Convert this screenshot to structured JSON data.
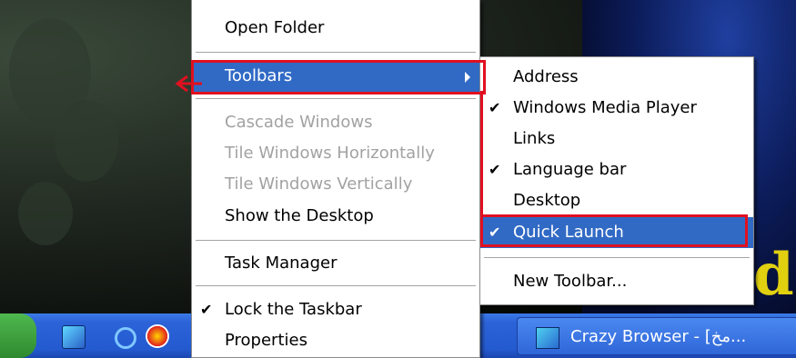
{
  "context_menu": {
    "items": [
      {
        "label": "Open Folder",
        "enabled": true
      },
      {
        "label": "Toolbars",
        "enabled": true,
        "highlighted": true,
        "has_submenu": true
      },
      {
        "label": "Cascade Windows",
        "enabled": false
      },
      {
        "label": "Tile Windows Horizontally",
        "enabled": false
      },
      {
        "label": "Tile Windows Vertically",
        "enabled": false
      },
      {
        "label": "Show the Desktop",
        "enabled": true
      },
      {
        "label": "Task Manager",
        "enabled": true
      },
      {
        "label": "Lock the Taskbar",
        "enabled": true,
        "checked": true
      },
      {
        "label": "Properties",
        "enabled": true
      }
    ]
  },
  "toolbars_submenu": {
    "items": [
      {
        "label": "Address",
        "checked": false
      },
      {
        "label": "Windows Media Player",
        "checked": true
      },
      {
        "label": "Links",
        "checked": false
      },
      {
        "label": "Language bar",
        "checked": true
      },
      {
        "label": "Desktop",
        "checked": false
      },
      {
        "label": "Quick Launch",
        "checked": true,
        "highlighted": true
      },
      {
        "label": "New Toolbar...",
        "checked": false
      }
    ]
  },
  "taskbar": {
    "task_button_label": "Crazy Browser - [مخ...",
    "quick_launch_icons": [
      "crazy-browser-icon",
      "internet-explorer-icon",
      "media-icon"
    ]
  },
  "check_glyph": "✔",
  "colors": {
    "highlight": "#316ac5",
    "annotation": "#e01020",
    "taskbar": "#245ad0",
    "disabled_text": "#a2a2a2"
  }
}
